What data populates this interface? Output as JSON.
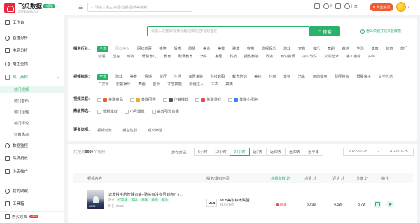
{
  "app": {
    "logo_title": "飞瓜数据",
    "logo_badge": "抖音版",
    "logo_sub": "DY.FEIGUA.CN"
  },
  "header": {
    "search_placeholder": "请输入播主/商品/直播/品牌等搜索",
    "icons": [
      {
        "icon": "cart-icon",
        "label": ""
      },
      {
        "icon": "bell-icon",
        "label": "9"
      },
      {
        "icon": "calendar-icon",
        "label": ""
      },
      {
        "icon": "share-icon",
        "label": "分享"
      }
    ],
    "pro_button": "专业会员"
  },
  "sidebar": {
    "items": [
      {
        "label": "工作台",
        "icon": "desk-icon",
        "has_chevron": false
      },
      {
        "label": "直播分析",
        "icon": "live-icon",
        "has_chevron": true
      },
      {
        "label": "电商分析",
        "icon": "shop-icon",
        "has_chevron": true
      },
      {
        "label": "播主查找",
        "icon": "user-search-icon",
        "has_chevron": true
      },
      {
        "label": "热门素材",
        "icon": "fire-icon",
        "has_chevron": true,
        "active": true
      },
      {
        "label": "数据监控",
        "icon": "monitor-icon",
        "has_chevron": true
      },
      {
        "label": "品牌投放",
        "icon": "brand-icon",
        "has_chevron": true
      },
      {
        "label": "小店推广",
        "icon": "store-icon",
        "has_chevron": true
      }
    ],
    "subitems": [
      "热门视频",
      "热门音乐",
      "热门话题",
      "热门评论",
      "抖音热点"
    ],
    "active_sub": "热门视频",
    "footer_items": [
      "我的收藏",
      "工具箱"
    ],
    "bottom": {
      "label": "购买续费",
      "badge": "NEW"
    }
  },
  "search": {
    "placeholder": "请输入关键词/视频标题/视频内容/视频描述",
    "button": "搜索",
    "help": "怎么快速打造抖音爆款"
  },
  "filters": {
    "industry": {
      "label": "播主行业:",
      "tags": [
        "全部",
        "网红美女",
        "网红帅哥",
        "搞笑",
        "情感",
        "剧情",
        "美食",
        "美妆",
        "种草",
        "穿搭",
        "影视娱乐",
        "游戏",
        "宠物",
        "音乐",
        "舞蹈",
        "萌娃",
        "生活",
        "健康",
        "体育",
        "旅行",
        "动漫",
        "创意",
        "时尚",
        "母婴育儿",
        "教育",
        "职场教育",
        "汽车",
        "家居",
        "科技",
        "摄影教学",
        "政务",
        "知识资讯",
        "办公软件",
        "文学艺术",
        "手工手绘",
        "户外"
      ],
      "first_muted": "网红美女"
    },
    "video_tags": {
      "label": "视频标签:",
      "tags": [
        "全部",
        "游戏",
        "美食",
        "情感",
        "旅行",
        "生活",
        "家居家装",
        "科技数码",
        "教育培训",
        "美妆",
        "时尚",
        "宠物",
        "汽车",
        "运动健身",
        "财经投资",
        "母婴亲子",
        "文学艺术",
        "二次元",
        "影视娱乐",
        "舞蹈",
        "音乐",
        "才艺技能",
        "颜值达人",
        "三农",
        "搞笑"
      ]
    },
    "video_assoc": {
      "label": "视频关联:",
      "items": [
        {
          "label": "关联商品",
          "icon": "goods-icon",
          "color": "#f25a31"
        },
        {
          "label": "关联团购",
          "icon": "group-icon",
          "color": "#f5a623"
        },
        {
          "label": "作者推荐",
          "icon": "recommend-icon",
          "color": "#555555"
        },
        {
          "label": "关联游戏",
          "icon": "game-icon",
          "color": "#e84a4a"
        },
        {
          "label": "关联小程序",
          "icon": "miniapp-icon",
          "color": "#3b82f6"
        }
      ]
    },
    "advanced": {
      "label": "高级筛选:",
      "items": [
        "低粉爆款",
        "小号爆单",
        "高效引流直播"
      ]
    },
    "more": {
      "label": "更多选项:",
      "dropdowns": [
        "视频时长",
        "播主性别",
        "观众筛选"
      ]
    }
  },
  "list": {
    "total_prefix": "共搜到",
    "total_count": "990+",
    "total_suffix": "个视频",
    "time_label": "发布时间:",
    "time_tabs": [
      "6小时",
      "12小时",
      "24小时",
      "近7天",
      "近30天",
      "近90天",
      "近半年"
    ],
    "active_tab": "24小时",
    "date_start": "2022-01-25",
    "date_sep": "-",
    "date_end": "2022-01-25",
    "columns": [
      "视频内容",
      "播主/发布时间",
      "传播指数",
      "点赞",
      "评论",
      "分享",
      "操作"
    ],
    "rows": [
      {
        "title": "这泼投手的筐球运躲+骑头有没有男到你？#...",
        "hot_label": "热点:",
        "tags": [
          "打篮球",
          "篮球",
          "棒球",
          "投掷",
          "躲头"
        ],
        "time": "时长: 00:09",
        "duration": "00:09",
        "anchor_logo": "MLB",
        "anchor_name": "MLB美职棒大联盟",
        "anchor_fans": "31.0万粉丝",
        "score": "58.8",
        "likes": "80.9w",
        "comments": "4.5w",
        "shares": "8.7w"
      }
    ]
  }
}
